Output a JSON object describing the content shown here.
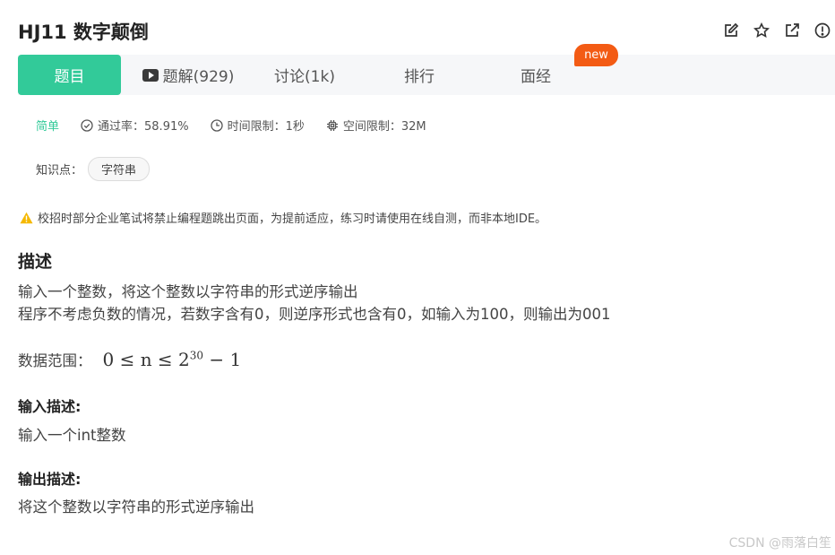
{
  "header": {
    "title": "HJ11  数字颠倒"
  },
  "toolbar_icons": [
    "edit-icon",
    "star-icon",
    "share-icon",
    "report-icon"
  ],
  "tabs": [
    {
      "label": "题目"
    },
    {
      "label": "题解(929)",
      "icon": "video-icon"
    },
    {
      "label": "讨论(1k)"
    },
    {
      "label": "排行"
    },
    {
      "label": "面经"
    }
  ],
  "new_badge": "new",
  "meta": {
    "difficulty": "简单",
    "pass_rate": "通过率：58.91%",
    "time_limit": "时间限制：1秒",
    "space_limit": "空间限制：32M"
  },
  "knowledge": {
    "label": "知识点：",
    "tag": "字符串"
  },
  "warning": "校招时部分企业笔试将禁止编程题跳出页面，为提前适应，练习时请使用在线自测，而非本地IDE。",
  "description": {
    "heading": "描述",
    "line1": "输入一个整数，将这个整数以字符串的形式逆序输出",
    "line2": "程序不考虑负数的情况，若数字含有0，则逆序形式也含有0，如输入为100，则输出为001",
    "range_label": "数据范围：",
    "range_math_pre": "0 ≤ n ≤ 2",
    "range_math_exp": "30",
    "range_math_post": " − 1"
  },
  "input_desc": {
    "heading": "输入描述:",
    "text": "输入一个int整数"
  },
  "output_desc": {
    "heading": "输出描述:",
    "text": "将这个整数以字符串的形式逆序输出"
  },
  "watermark": "CSDN @雨落白笙",
  "colors": {
    "accent": "#32ca99",
    "badge": "#f35b14",
    "warning": "#f5b800"
  }
}
